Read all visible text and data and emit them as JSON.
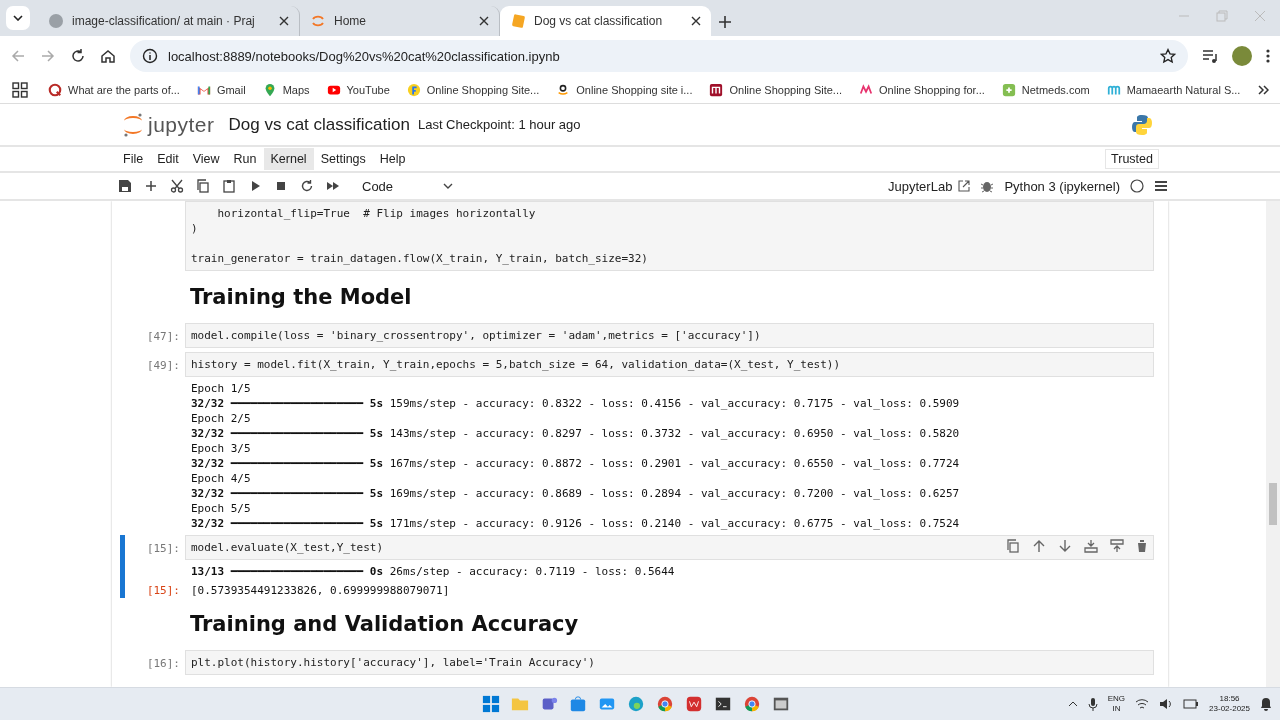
{
  "browser": {
    "tabs": [
      {
        "title": "image-classification/ at main · Praj",
        "selected": false
      },
      {
        "title": "Home",
        "selected": false
      },
      {
        "title": "Dog vs cat classification",
        "selected": true
      }
    ],
    "url": "localhost:8889/notebooks/Dog%20vs%20cat%20classification.ipynb",
    "bookmarks": [
      "What are the parts of...",
      "Gmail",
      "Maps",
      "YouTube",
      "Online Shopping Site...",
      "Online Shopping site i...",
      "Online Shopping Site...",
      "Online Shopping for...",
      "Netmeds.com",
      "Mamaearth Natural S..."
    ]
  },
  "notebook": {
    "logo": "jupyter",
    "title": "Dog vs cat classification",
    "checkpoint": "Last Checkpoint: 1 hour ago",
    "menu": [
      {
        "label": "File",
        "selected": false
      },
      {
        "label": "Edit",
        "selected": false
      },
      {
        "label": "View",
        "selected": false
      },
      {
        "label": "Run",
        "selected": false
      },
      {
        "label": "Kernel",
        "selected": true
      },
      {
        "label": "Settings",
        "selected": false
      },
      {
        "label": "Help",
        "selected": false
      }
    ],
    "trusted": "Trusted",
    "cell_type": "Code",
    "jupyterlab": "JupyterLab",
    "kernel": "Python 3 (ipykernel)"
  },
  "cells": [
    {
      "kind": "code",
      "selected": false,
      "blocks": [
        [
          "    horizontal_flip=True  # Flip images horizontally",
          ")"
        ],
        [
          "train_generator = train_datagen.flow(X_train, Y_train, batch_size=32)"
        ]
      ]
    },
    {
      "kind": "heading",
      "text": "Training the Model"
    },
    {
      "kind": "code",
      "prompt": "[47]:",
      "selected": false,
      "lines": [
        "model.compile(loss = 'binary_crossentropy', optimizer = 'adam',metrics = ['accuracy'])"
      ]
    },
    {
      "kind": "code",
      "prompt": "[49]:",
      "selected": false,
      "lines": [
        "history = model.fit(X_train, Y_train,epochs = 5,batch_size = 64, validation_data=(X_test, Y_test))"
      ],
      "outputs": [
        {
          "lines": [
            "Epoch 1/5",
            "**32/32** ━━━━━━━━━━━━━━━━━━━━ **5s** 159ms/step - accuracy: 0.8322 - loss: 0.4156 - val_accuracy: 0.7175 - val_loss: 0.5909",
            "Epoch 2/5",
            "**32/32** ━━━━━━━━━━━━━━━━━━━━ **5s** 143ms/step - accuracy: 0.8297 - loss: 0.3732 - val_accuracy: 0.6950 - val_loss: 0.5820",
            "Epoch 3/5",
            "**32/32** ━━━━━━━━━━━━━━━━━━━━ **5s** 167ms/step - accuracy: 0.8872 - loss: 0.2901 - val_accuracy: 0.6550 - val_loss: 0.7724",
            "Epoch 4/5",
            "**32/32** ━━━━━━━━━━━━━━━━━━━━ **5s** 169ms/step - accuracy: 0.8689 - loss: 0.2894 - val_accuracy: 0.7200 - val_loss: 0.6257",
            "Epoch 5/5",
            "**32/32** ━━━━━━━━━━━━━━━━━━━━ **5s** 171ms/step - accuracy: 0.9126 - loss: 0.2140 - val_accuracy: 0.6775 - val_loss: 0.7524"
          ]
        }
      ]
    },
    {
      "kind": "code",
      "prompt": "[15]:",
      "selected": true,
      "lines": [
        "model.evaluate(X_test,Y_test)"
      ],
      "outputs": [
        {
          "lines": [
            "**13/13** ━━━━━━━━━━━━━━━━━━━━ **0s** 26ms/step - accuracy: 0.7119 - loss: 0.5644"
          ]
        },
        {
          "prompt": "[15]:",
          "lines": [
            "[0.5739354491233826, 0.699999988079071]"
          ]
        }
      ]
    },
    {
      "kind": "heading",
      "text": "Training and Validation Accuracy"
    },
    {
      "kind": "code",
      "prompt": "[16]:",
      "selected": false,
      "lines": [
        "plt.plot(history.history['accuracy'], label='Train Accuracy')"
      ]
    }
  ],
  "taskbar": {
    "lang": "ENG",
    "region": "IN",
    "time": "18:56",
    "date": "23-02-2025"
  }
}
